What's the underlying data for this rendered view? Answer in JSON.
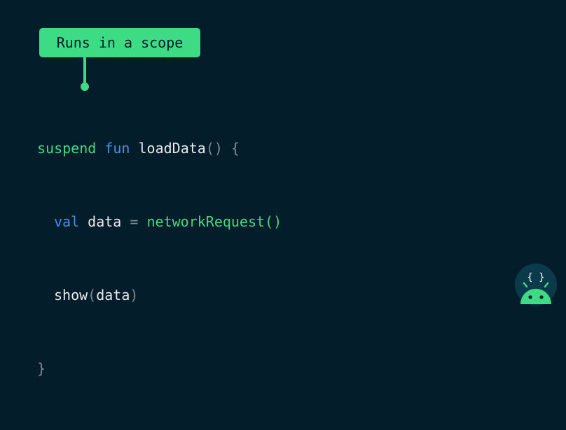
{
  "callout": {
    "label": "Runs in a scope"
  },
  "code": {
    "line1": {
      "keyword_suspend": "suspend",
      "keyword_fun": "fun",
      "function_name": "loadData",
      "parens": "()",
      "open_brace": "{"
    },
    "line2": {
      "keyword_val": "val",
      "variable": "data",
      "equals": "=",
      "call": "networkRequest()"
    },
    "line3": {
      "function": "show",
      "open_paren": "(",
      "argument": "data",
      "close_paren": ")"
    },
    "line4": {
      "close_brace": "}"
    }
  },
  "logo": {
    "icon": "android-coroutines-logo",
    "glyph": "{ }"
  },
  "colors": {
    "background": "#041d2b",
    "accent_green": "#3ddc84",
    "keyword_blue": "#4a90e2",
    "text": "#e8eaed",
    "punctuation": "#7f8c93"
  }
}
